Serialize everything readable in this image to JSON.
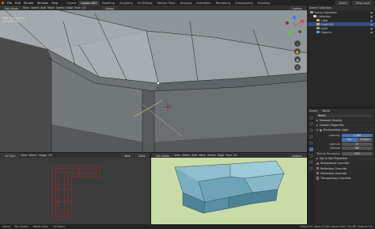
{
  "topbar": {
    "menu": [
      "File",
      "Edit",
      "Render",
      "Window",
      "Help"
    ],
    "tabs": [
      "Layout",
      "Layout.001",
      "Modeling",
      "Sculpting",
      "UV Editing",
      "Texture Paint",
      "Shading",
      "Animation",
      "Rendering",
      "Compositing",
      "Scripting"
    ],
    "active_tab": 1,
    "scene": "Scene",
    "view_layer": "View Layer"
  },
  "viewport": {
    "header": {
      "mode": "Edit Mode",
      "menus": [
        "View",
        "Select",
        "Add",
        "Mesh",
        "Vertex",
        "Edge",
        "Face",
        "UV"
      ],
      "transform": "Global",
      "options": "Options"
    },
    "overlay_text": [
      "User Perspective",
      "(1) Cube.001"
    ]
  },
  "outliner": {
    "header": "Scene Collection",
    "items": [
      {
        "label": "Scene Collection",
        "color": "#9a9a9a",
        "indent": 0
      },
      {
        "label": "Collection",
        "color": "#cfcfcf",
        "indent": 1
      },
      {
        "label": "Cube",
        "color": "#e8a54b",
        "indent": 2
      },
      {
        "label": "Cube.001",
        "color": "#e8a54b",
        "indent": 2
      },
      {
        "label": "Light",
        "color": "#6cc26c",
        "indent": 2
      },
      {
        "label": "Camera",
        "color": "#6a9ad8",
        "indent": 2
      }
    ],
    "selected_index": 3
  },
  "properties": {
    "tabs": [
      "Scene",
      "World"
    ],
    "world_name": "World",
    "sections": {
      "viewport_display": "Viewport Display",
      "custom_properties": "Custom Properties",
      "environment_light": "Environment Light"
    },
    "intensity": {
      "label": "Intensity",
      "value": "1.000"
    },
    "sky_type": {
      "left": "Sky",
      "right": "Custom"
    },
    "azimuth": {
      "label": "Azimuth",
      "value": "0°"
    },
    "altitude": {
      "label": "Altitude",
      "value": "90°"
    },
    "texture_resolution": {
      "label": "Texture Resolution",
      "value": "512"
    },
    "sun_sky": "Sun & Sky Properties",
    "checks": [
      "Background Override",
      "Reflection Override",
      "Refraction Override",
      "Transparency Override"
    ]
  },
  "uv_editor": {
    "header": {
      "mode": "UV Sync",
      "menus": [
        "View",
        "Select",
        "Image",
        "UV"
      ],
      "new": "New",
      "open": "Open"
    }
  },
  "viewport2": {
    "header": {
      "mode": "Edit Mode",
      "menus": [
        "View",
        "Select",
        "Add",
        "Mesh",
        "Vertex",
        "Edge",
        "Face",
        "UV"
      ],
      "options": "Options"
    }
  },
  "status": {
    "left": [
      "Select",
      "Box Select",
      "Rotate View",
      "Call Menu"
    ],
    "right": "Cube.001 | Verts:12/48 | Faces:0/40 | Tris:88 | Objects:1/4"
  },
  "colors": {
    "accent": "#4772b3",
    "active_orange": "#e87d0d",
    "uv_red": "#e02020"
  }
}
